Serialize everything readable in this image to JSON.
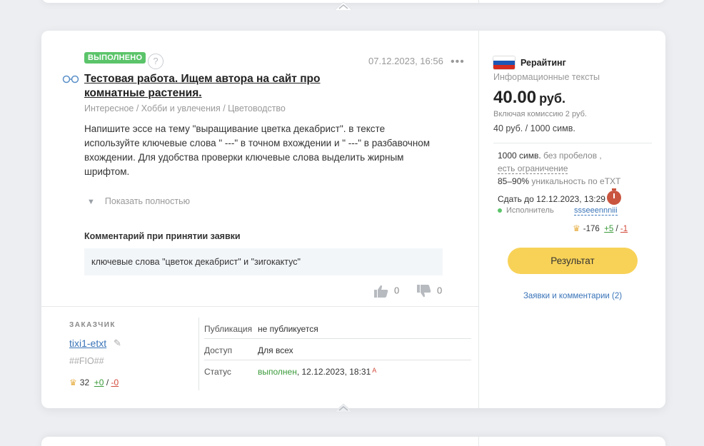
{
  "order": {
    "status_badge": "ВЫПОЛНЕНО",
    "help_label": "?",
    "date": "07.12.2023, 16:56",
    "more_label": "•••",
    "title": "Тестовая работа. Ищем автора на сайт про комнатные растения.",
    "breadcrumbs": "Интересное / Хобби и увлечения / Цветоводство",
    "description": "Напишите эссе на тему \"выращивание цветка декабрист\". в тексте используйте ключевые слова \" ---\" в точном вхождении и \" ---\" в разбавочном вхождении. Для удобства проверки ключевые слова выделить жирным шрифтом.",
    "show_more": "Показать полностью",
    "comment_heading": "Комментарий при принятии заявки",
    "comment_text": "ключевые слова \"цветок декабрист\" и \"зигокактус\"",
    "likes": "0",
    "dislikes": "0"
  },
  "customer": {
    "heading": "ЗАКАЗЧИК",
    "name": "tixi1-etxt",
    "fio": "##FIO##",
    "rating": "32",
    "plus": "+0",
    "slash": "/",
    "minus": "-0"
  },
  "meta": [
    {
      "key": "Публикация",
      "value": "не публикуется"
    },
    {
      "key": "Доступ",
      "value": "Для всех"
    },
    {
      "key": "Статус",
      "value": "выполнен",
      "date": ", 12.12.2023, 18:31",
      "mark": "A"
    }
  ],
  "sidebar": {
    "type": "Рерайтинг",
    "category": "Информационные тексты",
    "price": "40.00",
    "currency": "руб.",
    "commission": "Включая комиссию 2 руб.",
    "rate": "40 руб. / 1000 симв.",
    "volume": "1000 симв.",
    "volume_note": "без пробелов ,",
    "limit": "есть ограничение",
    "uniqueness_value": "85–90%",
    "uniqueness_label": "уникальность по eTXT",
    "deadline": "Сдать до 12.12.2023, 13:29",
    "executor_label": "Исполнитель",
    "executor_name": "ssseeennniii",
    "executor_rating": "-176",
    "executor_plus": "+5",
    "executor_slash": "/",
    "executor_minus": "-1",
    "result_button": "Результат",
    "applications_link": "Заявки и комментарии (2)"
  },
  "icons": [
    "chevron-up-icon",
    "glasses-icon",
    "help-icon",
    "more-icon",
    "chevron-down-icon",
    "thumbs-up-icon",
    "thumbs-down-icon",
    "pencil-icon",
    "crown-icon",
    "flag-icon",
    "timer-icon",
    "online-dot-icon"
  ],
  "colors": {
    "badge_green": "#5bc46a",
    "link_blue": "#3a74b8",
    "button_yellow": "#f8d257",
    "timer_red": "#c9553f"
  }
}
